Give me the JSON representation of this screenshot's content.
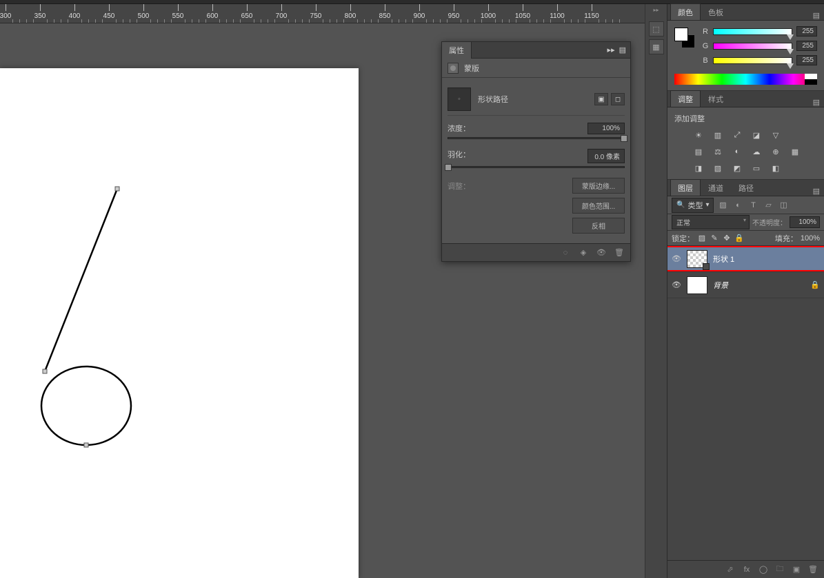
{
  "ruler": {
    "start": 300,
    "end": 1150,
    "step": 50
  },
  "props": {
    "tab": "属性",
    "mask_label": "蒙版",
    "shape_path": "形状路径",
    "density_label": "浓度：",
    "density_value": "100%",
    "feather_label": "羽化：",
    "feather_value": "0.0 像素",
    "adjust_label": "调整：",
    "mask_edge": "蒙版边缘...",
    "color_range": "颜色范围...",
    "invert": "反相"
  },
  "color": {
    "tab1": "颜色",
    "tab2": "色板",
    "r": "R",
    "r_val": "255",
    "g": "G",
    "g_val": "255",
    "b": "B",
    "b_val": "255"
  },
  "adjust": {
    "tab1": "调整",
    "tab2": "样式",
    "title": "添加调整"
  },
  "layers": {
    "tab1": "图层",
    "tab2": "通道",
    "tab3": "路径",
    "filter_type": "类型",
    "blend": "正常",
    "opacity_label": "不透明度：",
    "opacity_value": "100%",
    "lock_label": "锁定：",
    "fill_label": "填充：",
    "fill_value": "100%",
    "items": [
      {
        "name": "形状 1",
        "selected": true,
        "locked": false,
        "checker": true
      },
      {
        "name": "背景",
        "selected": false,
        "locked": true,
        "checker": false,
        "italic": true
      }
    ]
  }
}
